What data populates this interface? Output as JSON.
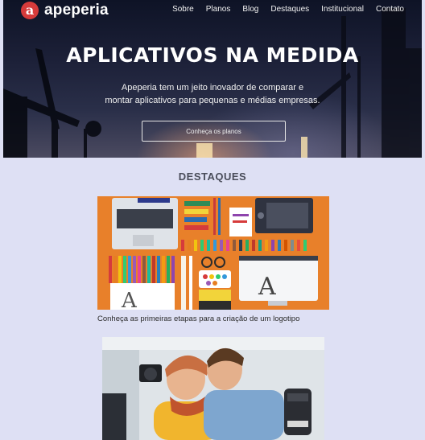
{
  "header": {
    "brand_letter": "a",
    "brand_name": "apeperia",
    "nav": [
      "Sobre",
      "Planos",
      "Blog",
      "Destaques",
      "Institucional",
      "Contato"
    ]
  },
  "hero": {
    "title": "APLICATIVOS NA MEDIDA",
    "subtitle_line1": "Apeperia tem um jeito inovador de comparar e",
    "subtitle_line2": "montar aplicativos para pequenas e médias empresas.",
    "cta_label": "Conheça os planos"
  },
  "destaques": {
    "title": "DESTAQUES",
    "items": [
      {
        "caption": "Conheça as primeiras etapas para a criação de um logotipo"
      }
    ]
  },
  "colors": {
    "brand_red": "#d63b3b",
    "page_background": "#dee0f4",
    "card_orange": "#e8802a"
  }
}
